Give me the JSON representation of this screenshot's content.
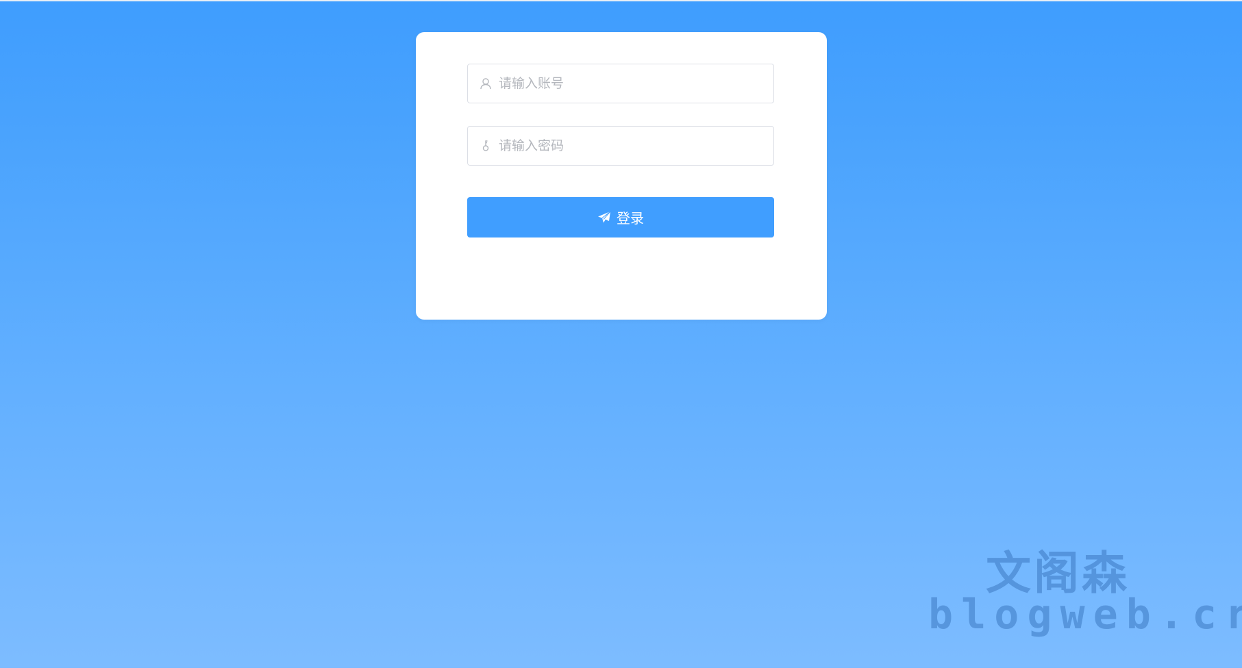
{
  "login_form": {
    "account": {
      "placeholder": "请输入账号",
      "value": "",
      "icon": "user-icon"
    },
    "password": {
      "placeholder": "请输入密码",
      "value": "",
      "icon": "key-icon"
    },
    "submit": {
      "label": "登录",
      "icon": "paper-plane-icon"
    }
  },
  "watermark": {
    "line1": "文阁森",
    "line2": "blogweb.cr"
  },
  "colors": {
    "primary": "#409eff",
    "background_top": "#3f9dfe",
    "background_bottom": "#7dbcff",
    "card": "#ffffff",
    "placeholder": "#b4b7bd",
    "border": "#dcdfe6"
  }
}
